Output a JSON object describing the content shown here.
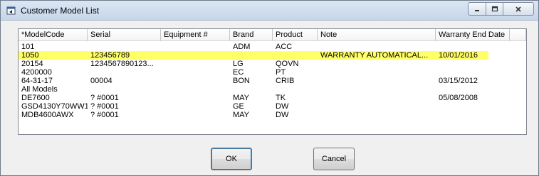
{
  "window": {
    "title": "Customer Model List"
  },
  "columns": [
    "*ModelCode",
    "Serial",
    "Equipment #",
    "Brand",
    "Product",
    "Note",
    "Warranty End Date"
  ],
  "rows": [
    {
      "model": "101",
      "serial": "",
      "equipment": "",
      "brand": "ADM",
      "product": "ACC",
      "note": "",
      "warranty": "",
      "selected": false
    },
    {
      "model": "1050",
      "serial": "123456789",
      "equipment": "",
      "brand": "",
      "product": "",
      "note": "WARRANTY AUTOMATICAL...",
      "warranty": "10/01/2016",
      "selected": true
    },
    {
      "model": "20154",
      "serial": "1234567890123...",
      "equipment": "",
      "brand": "LG",
      "product": "QOVN",
      "note": "",
      "warranty": "",
      "selected": false
    },
    {
      "model": "4200000",
      "serial": "",
      "equipment": "",
      "brand": "EC",
      "product": "PT",
      "note": "",
      "warranty": "",
      "selected": false
    },
    {
      "model": "64-31-17",
      "serial": "00004",
      "equipment": "",
      "brand": "BON",
      "product": "CRIB",
      "note": "",
      "warranty": "03/15/2012",
      "selected": false
    },
    {
      "model": "All Models",
      "serial": "",
      "equipment": "",
      "brand": "",
      "product": "",
      "note": "",
      "warranty": "",
      "selected": false
    },
    {
      "model": "DE7600",
      "serial": "? #0001",
      "equipment": "",
      "brand": "MAY",
      "product": "TK",
      "note": "",
      "warranty": "05/08/2008",
      "selected": false
    },
    {
      "model": "GSD4130Y70WW1",
      "serial": "? #0001",
      "equipment": "",
      "brand": "GE",
      "product": "DW",
      "note": "",
      "warranty": "",
      "selected": false
    },
    {
      "model": "MDB4600AWX",
      "serial": "? #0001",
      "equipment": "",
      "brand": "MAY",
      "product": "DW",
      "note": "",
      "warranty": "",
      "selected": false
    }
  ],
  "buttons": {
    "ok": "OK",
    "cancel": "Cancel"
  },
  "colors": {
    "selected_row": "#ffff66",
    "titlebar": "#c6d6ea"
  },
  "icons": {
    "app": "window-app-icon",
    "minimize": "minimize-icon",
    "maximize": "maximize-icon",
    "close": "close-icon"
  }
}
